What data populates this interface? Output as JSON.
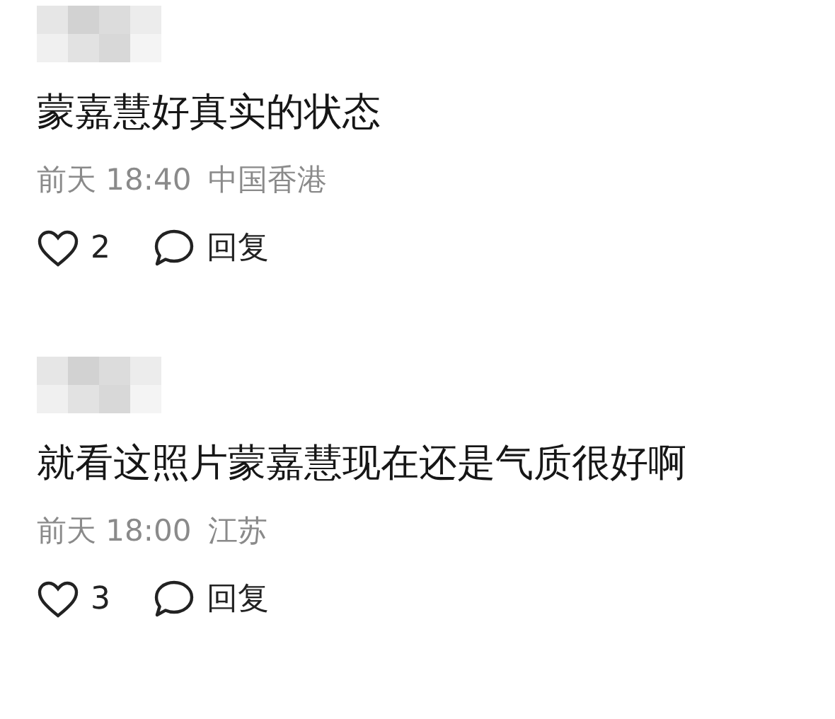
{
  "comments": [
    {
      "author_hidden": true,
      "text": "蒙嘉慧好真实的状态",
      "date": "前天 18:40",
      "location": "中国香港",
      "likes": "2",
      "reply": "回复"
    },
    {
      "author_hidden": true,
      "text": "就看这照片蒙嘉慧现在还是气质很好啊",
      "date": "前天 18:00",
      "location": "江苏",
      "likes": "3",
      "reply": "回复"
    }
  ]
}
